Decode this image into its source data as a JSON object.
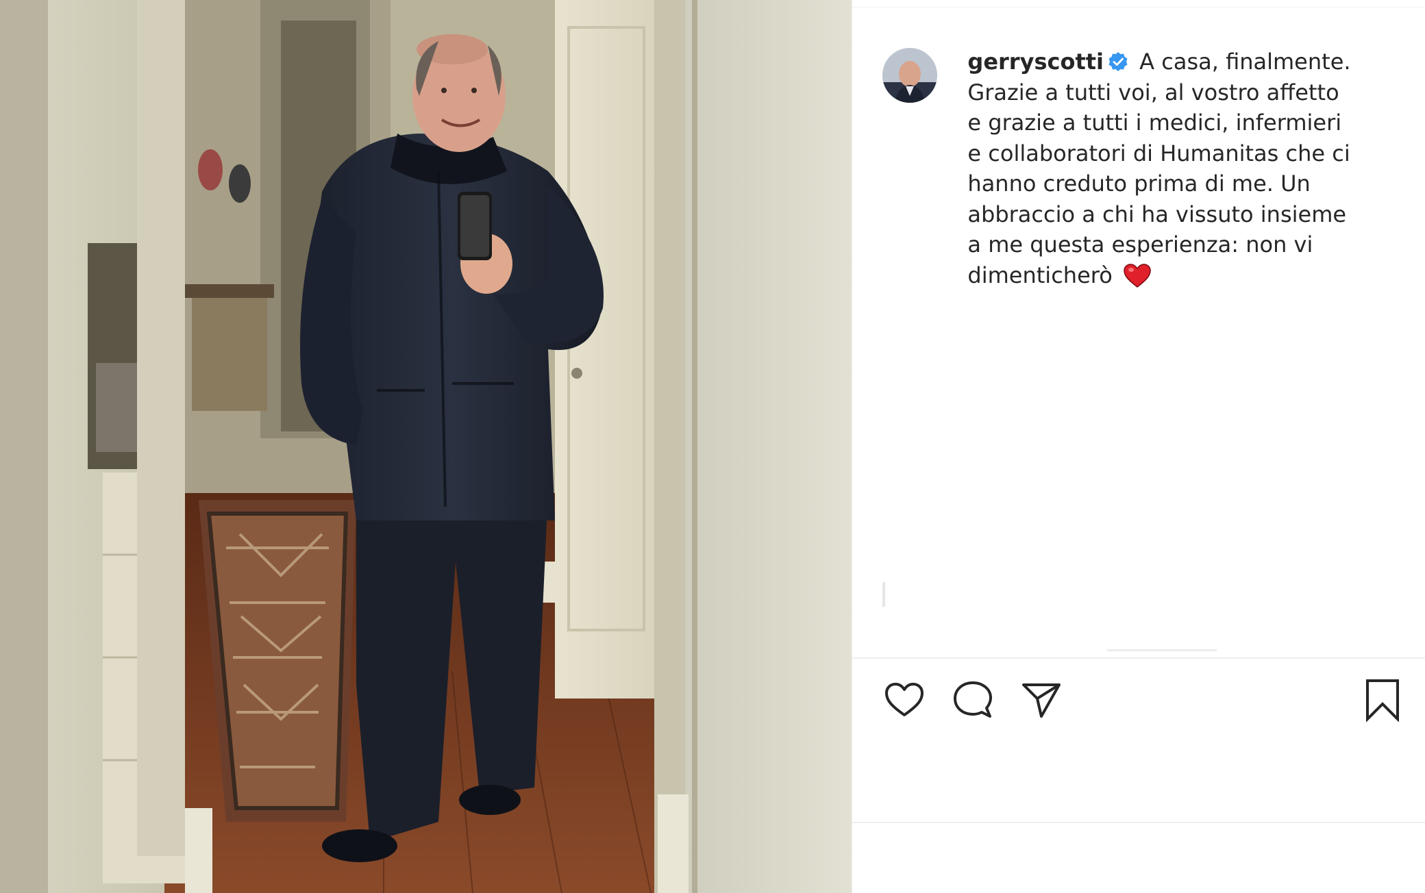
{
  "post": {
    "username": "gerryscotti",
    "caption": "A casa, finalmente. Grazie a tutti voi, al vostro affetto e grazie a tutti i medici, infermieri e collaboratori di Humanitas che ci hanno creduto prima di me. Un abbraccio a chi ha vissuto insieme a me questa esperienza: non vi dimenticherò",
    "verified": true,
    "caption_emoji": "red-heart-emoji"
  },
  "actions": {
    "like_icon": "heart-outline-icon",
    "comment_icon": "comment-bubble-icon",
    "share_icon": "paper-plane-icon",
    "save_icon": "bookmark-icon"
  },
  "colors": {
    "text": "#262626",
    "verified_badge": "#3897f0",
    "heart": "#e0202a",
    "divider": "#efefef"
  }
}
